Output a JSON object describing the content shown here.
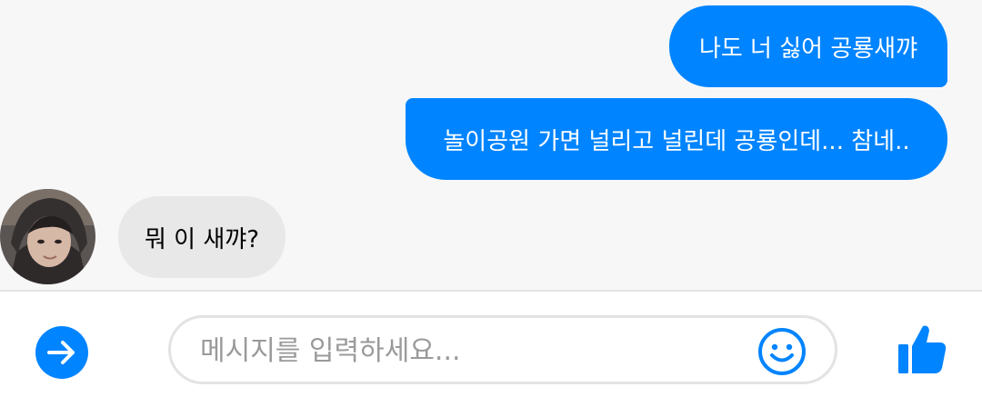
{
  "messages": [
    {
      "direction": "outgoing",
      "text": "나도 너 싫어 공룡새꺄"
    },
    {
      "direction": "outgoing",
      "text": "놀이공원 가면 널리고 널린데 공룡인데... 참네.."
    },
    {
      "direction": "incoming",
      "text": "뭐 이 새꺄?"
    }
  ],
  "composer": {
    "placeholder": "메시지를 입력하세요..."
  },
  "icons": {
    "send": "arrow-right-icon",
    "emoji": "smiley-icon",
    "like": "thumbs-up-icon"
  },
  "colors": {
    "accent": "#0084ff",
    "incoming_bubble": "#e8e8e8",
    "background": "#f7f7f7"
  }
}
